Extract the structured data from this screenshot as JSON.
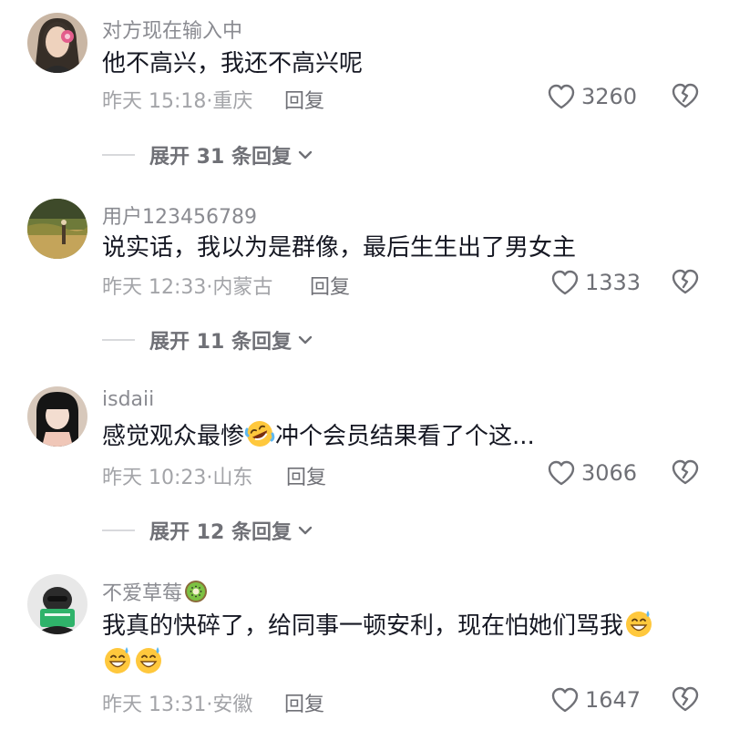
{
  "comments": [
    {
      "username": "对方现在输入中",
      "content": "他不高兴，我还不高兴呢",
      "time": "昨天 15:18",
      "location": "重庆",
      "reply_label": "回复",
      "likes": "3260",
      "expand": {
        "prefix": "展开 ",
        "count": "31",
        "suffix": " 条回复"
      }
    },
    {
      "username": "用户123456789",
      "content": "说实话，我以为是群像，最后生生出了男女主",
      "time": "昨天 12:33",
      "location": "内蒙古",
      "reply_label": "回复",
      "likes": "1333",
      "expand": {
        "prefix": "展开 ",
        "count": "11",
        "suffix": " 条回复"
      }
    },
    {
      "username": "isdaii",
      "content_before": "感觉观众最惨",
      "content_emoji": "rofl-emoji",
      "content_after": "冲个会员结果看了个这...",
      "time": "昨天 10:23",
      "location": "山东",
      "reply_label": "回复",
      "likes": "3066",
      "expand": {
        "prefix": "展开 ",
        "count": "12",
        "suffix": " 条回复"
      }
    },
    {
      "username": "不爱草莓",
      "username_emoji": "kiwi-emoji",
      "content": "我真的快碎了，给同事一顿安利，现在怕她们骂我",
      "content_emoji": "grin-sweat-emoji",
      "time": "昨天 13:31",
      "location": "安徽",
      "reply_label": "回复",
      "likes": "1647"
    }
  ],
  "meta_separator": "·",
  "colors": {
    "text_primary": "#161823",
    "text_secondary": "#8a8b91",
    "text_meta": "#a3a4a8",
    "icon_gray": "#6f7076"
  }
}
